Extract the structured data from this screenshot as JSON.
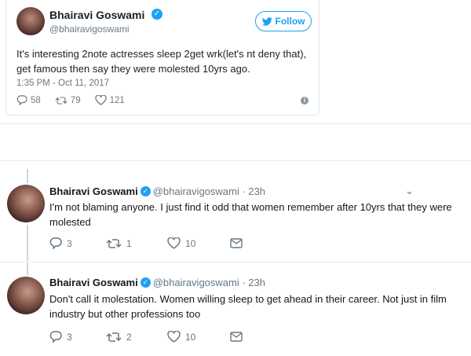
{
  "embed": {
    "name": "Bhairavi Goswami",
    "handle": "@bhairavigoswami",
    "follow_label": "Follow",
    "text": "It's interesting 2note actresses sleep 2get wrk(let's nt deny that), get famous then say they were molested 10yrs ago.",
    "time": "1:35 PM - Oct 11, 2017",
    "replies": "58",
    "retweets": "79",
    "likes": "121"
  },
  "replies": [
    {
      "name": "Bhairavi Goswami",
      "handle_time": "@bhairavigoswami · 23h",
      "text": "I'm not blaming anyone. I just find it odd that women remember after 10yrs that they were molested",
      "replies": "3",
      "retweets": "1",
      "likes": "10"
    },
    {
      "name": "Bhairavi Goswami",
      "handle_time": "@bhairavigoswami · 23h",
      "text": "Don't call it molestation. Women willing sleep to get ahead in their career. Not just in film industry but other professions too",
      "replies": "3",
      "retweets": "2",
      "likes": "10"
    }
  ],
  "icons": {
    "accent": "#1da1f2",
    "reply": "reply-icon",
    "retweet": "retweet-icon",
    "like": "heart-icon",
    "dm": "envelope-icon",
    "info": "info-icon",
    "verified": "verified-badge-icon",
    "bird": "twitter-bird-icon",
    "caret": "chevron-down-icon"
  }
}
